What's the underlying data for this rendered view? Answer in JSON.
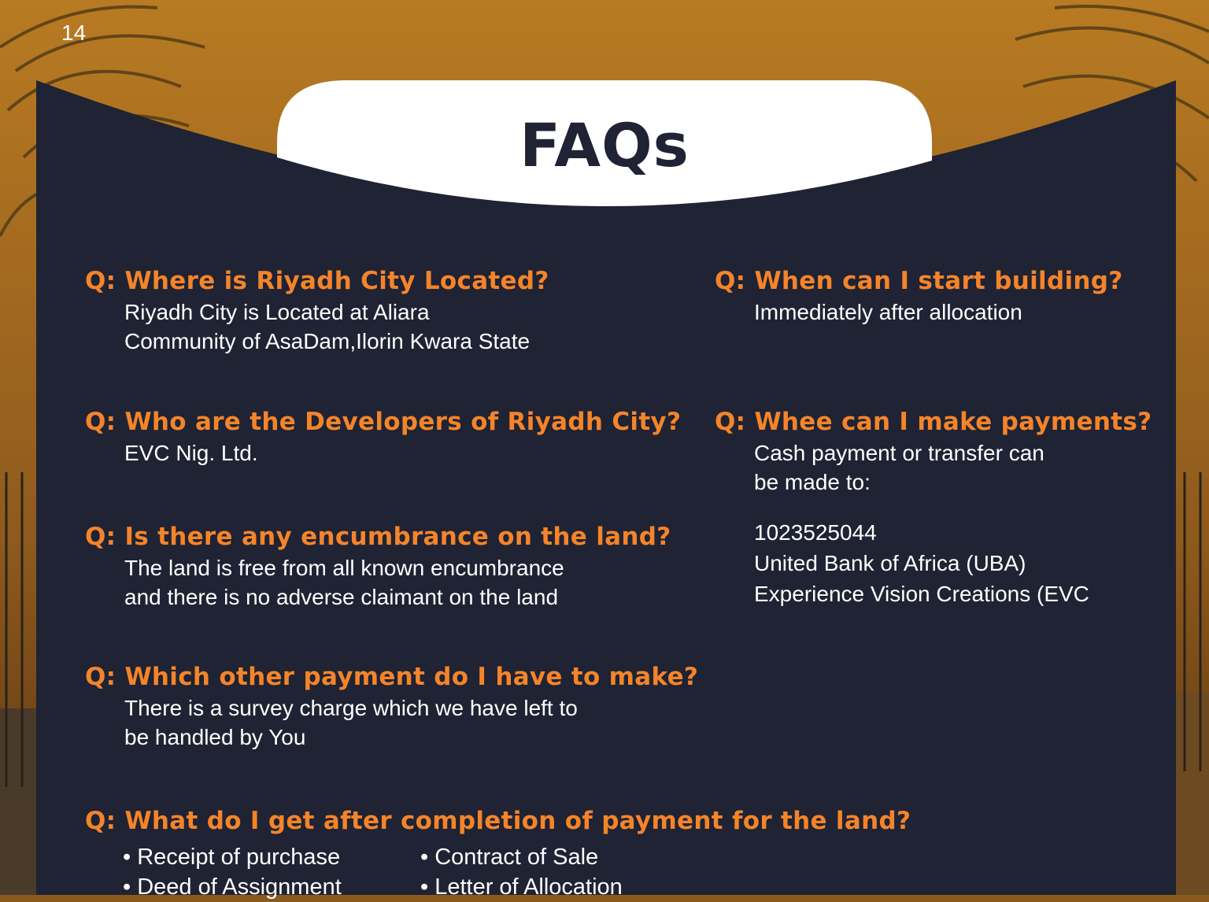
{
  "page": {
    "number": "14",
    "title": "FAQs"
  },
  "colors": {
    "panel": "#1f2333",
    "accent": "#f4842a",
    "sky": "#b8761f",
    "text": "#ffffff"
  },
  "faqs": [
    {
      "q": "Q: Where is Riyadh City Located?",
      "a": [
        "Riyadh City is Located at Aliara",
        "Community of AsaDam,Ilorin Kwara State"
      ]
    },
    {
      "q": "Q: Who are the Developers of Riyadh City?",
      "a": [
        "EVC Nig. Ltd."
      ]
    },
    {
      "q": "Q: Is there any encumbrance on the land?",
      "a": [
        "The land is free from all known encumbrance",
        "and there is no adverse claimant on the land"
      ]
    },
    {
      "q": "Q: Which other payment do I have to make?",
      "a": [
        "There is a survey charge which we have left to",
        "be handled by You"
      ]
    },
    {
      "q": "Q: When can I start building?",
      "a": [
        "Immediately after allocation"
      ]
    },
    {
      "q": "Q: Whee can I make payments?",
      "a": [
        "Cash payment or transfer can",
        "be made to:"
      ],
      "bank": [
        "1023525044",
        "United Bank of Africa (UBA)",
        "Experience Vision Creations (EVC"
      ]
    }
  ],
  "completion": {
    "q": "Q: What do I get after completion of payment for the land?",
    "items": [
      "• Receipt of purchase",
      "• Contract of Sale",
      "• Deed of Assignment",
      "• Letter of Allocation"
    ]
  }
}
